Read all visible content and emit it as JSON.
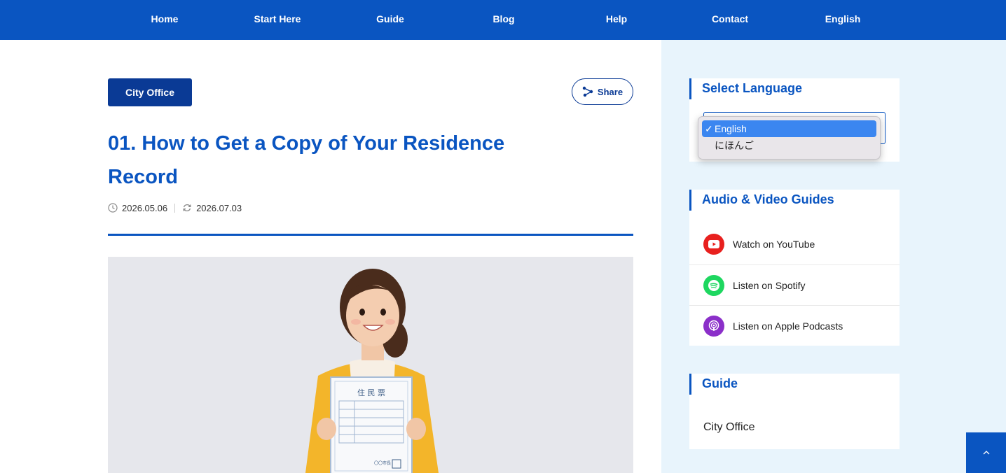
{
  "nav": {
    "items": [
      {
        "label": "Home"
      },
      {
        "label": "Start Here"
      },
      {
        "label": "Guide"
      },
      {
        "label": "Blog"
      },
      {
        "label": "Help"
      },
      {
        "label": "Contact"
      },
      {
        "label": "English"
      }
    ]
  },
  "article": {
    "category": "City Office",
    "share_label": "Share",
    "title": "01. How to Get a Copy of Your Residence Record",
    "published": "2026.05.06",
    "updated": "2026.07.03",
    "hero_image": {
      "document_title": "住 民 票",
      "document_footer": "〇〇市長"
    }
  },
  "sidebar": {
    "language": {
      "heading": "Select Language",
      "selected": "English",
      "options": [
        {
          "label": "English",
          "check": "✓"
        },
        {
          "label": "にほんご"
        }
      ]
    },
    "media": {
      "heading": "Audio & Video Guides",
      "items": [
        {
          "label": "Watch on YouTube",
          "icon": "youtube-icon",
          "color": "#e8201e"
        },
        {
          "label": "Listen on Spotify",
          "icon": "spotify-icon",
          "color": "#1ed760"
        },
        {
          "label": "Listen on Apple Podcasts",
          "icon": "podcast-icon",
          "color": "#8b2fc9"
        }
      ]
    },
    "guide": {
      "heading": "Guide",
      "items": [
        {
          "label": "City Office"
        }
      ]
    }
  },
  "colors": {
    "brand": "#0a55c1",
    "brand_dark": "#0a3a95",
    "sidebar_bg": "#e8f4fc"
  }
}
